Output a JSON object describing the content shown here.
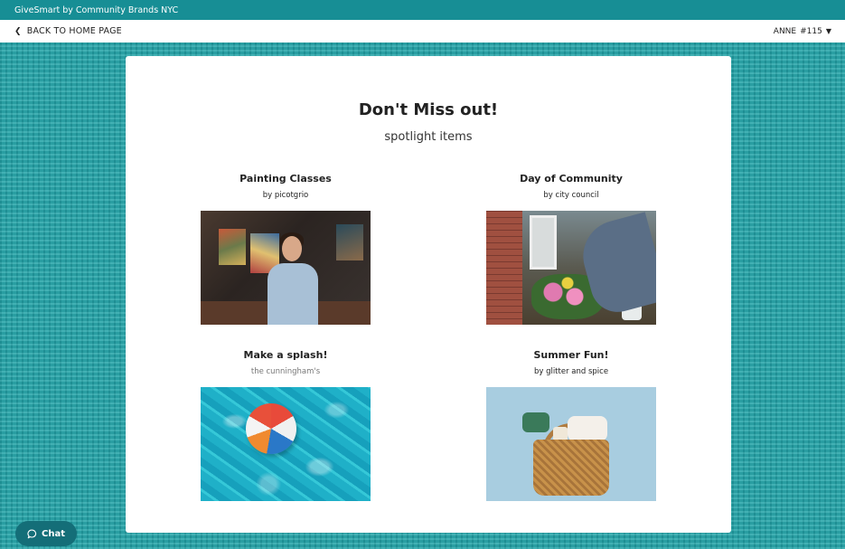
{
  "brand": {
    "text": "GiveSmart by Community Brands NYC"
  },
  "nav": {
    "back_label": "BACK TO HOME PAGE",
    "user_label": "ANNE",
    "user_number": "#115"
  },
  "spotlight": {
    "title": "Don't Miss out!",
    "subtitle": "spotlight items",
    "items": [
      {
        "name": "Painting Classes",
        "donor": "by picotgrio"
      },
      {
        "name": "Day of Community",
        "donor": "by city council"
      },
      {
        "name": "Make a splash!",
        "donor": "the cunningham's"
      },
      {
        "name": "Summer Fun!",
        "donor": "by glitter and spice"
      }
    ]
  },
  "chat": {
    "label": "Chat"
  },
  "colors": {
    "brand_bar": "#178e95",
    "background": "#22a3a8",
    "chat_button": "#146e78"
  }
}
